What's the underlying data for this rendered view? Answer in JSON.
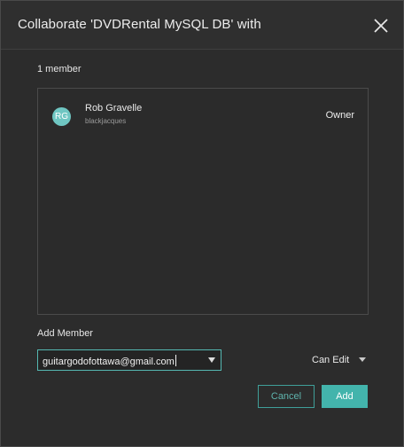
{
  "dialog": {
    "title": "Collaborate 'DVDRental MySQL DB' with"
  },
  "members": {
    "count_label": "1 member",
    "items": [
      {
        "initials": "RG",
        "name": "Rob Gravelle",
        "username": "blackjacques",
        "role": "Owner"
      }
    ]
  },
  "add_member": {
    "label": "Add Member",
    "email_value": "guitargodofottawa@gmail.com",
    "permission": "Can Edit"
  },
  "actions": {
    "cancel_label": "Cancel",
    "add_label": "Add"
  },
  "colors": {
    "accent": "#43b4ac",
    "avatar": "#6fc6c2",
    "background": "#2c2c2c"
  }
}
